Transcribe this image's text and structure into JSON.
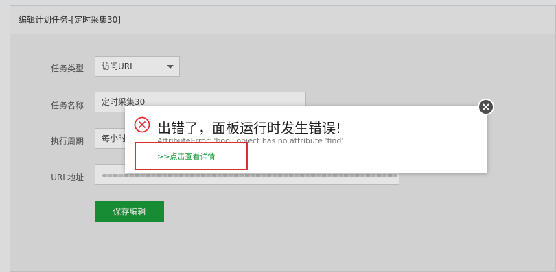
{
  "panel": {
    "title": "编辑计划任务-[定时采集30]"
  },
  "form": {
    "task_type": {
      "label": "任务类型",
      "value": "访问URL"
    },
    "task_name": {
      "label": "任务名称",
      "value": "定时采集30"
    },
    "cycle": {
      "label": "执行周期",
      "value": "每小时"
    },
    "url": {
      "label": "URL地址"
    },
    "save_label": "保存编辑"
  },
  "dialog": {
    "icon": "error-circle-x-icon",
    "title": "出错了，面板运行时发生错误!",
    "detail": "AttributeError: 'bool' object has no attribute 'find'",
    "link": ">>点击查看详情",
    "close_icon": "close-icon"
  },
  "colors": {
    "accent_green": "#1a9c3b",
    "error_red": "#e02d2d",
    "highlight_red": "#e02d2d"
  }
}
